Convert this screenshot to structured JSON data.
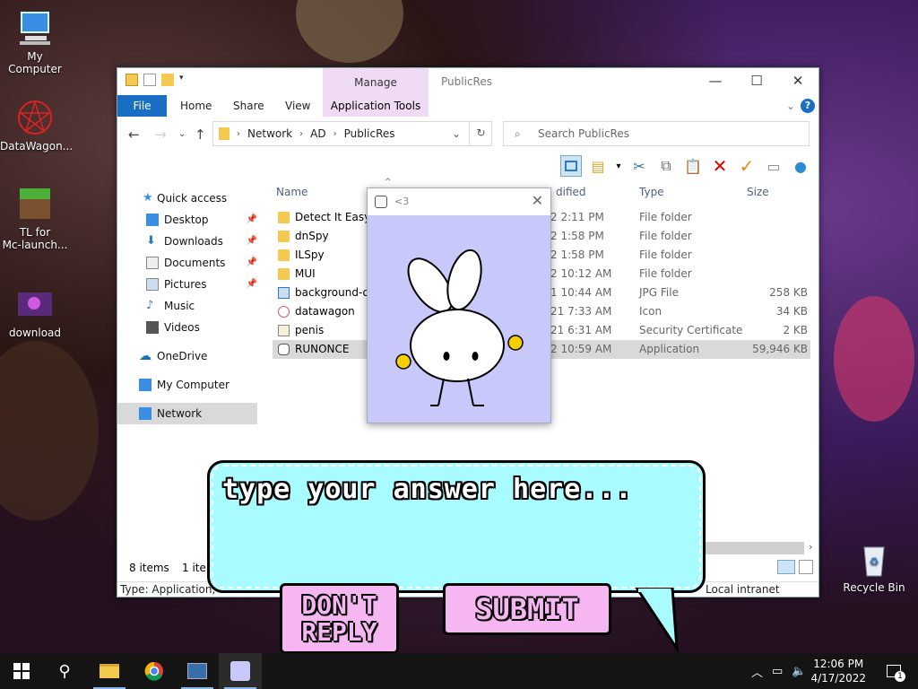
{
  "desktop": {
    "icons": [
      {
        "label": "My Computer"
      },
      {
        "label": "DataWagon..."
      },
      {
        "label": "TL for\nMc-launch..."
      },
      {
        "label": "download"
      },
      {
        "label": "Recycle Bin"
      }
    ]
  },
  "explorer": {
    "context_tab": "Manage",
    "window_title": "PublicRes",
    "ribbon_tabs": {
      "file": "File",
      "home": "Home",
      "share": "Share",
      "view": "View",
      "app_tools": "Application Tools"
    },
    "address": {
      "root": "Network",
      "mid": "AD",
      "current": "PublicRes"
    },
    "search_placeholder": "Search PublicRes",
    "nav": {
      "quick_access": "Quick access",
      "desktop": "Desktop",
      "downloads": "Downloads",
      "documents": "Documents",
      "pictures": "Pictures",
      "music": "Music",
      "videos": "Videos",
      "onedrive": "OneDrive",
      "my_computer": "My Computer",
      "network": "Network"
    },
    "columns": {
      "name": "Name",
      "modified": "dified",
      "type": "Type",
      "size": "Size"
    },
    "files": [
      {
        "name": "Detect It Easy",
        "date": "2 2:11 PM",
        "type": "File folder",
        "size": ""
      },
      {
        "name": "dnSpy",
        "date": "2 1:58 PM",
        "type": "File folder",
        "size": ""
      },
      {
        "name": "ILSpy",
        "date": "2 1:58 PM",
        "type": "File folder",
        "size": ""
      },
      {
        "name": "MUI",
        "date": "2 10:12 AM",
        "type": "File folder",
        "size": ""
      },
      {
        "name": "background-olo",
        "date": "1 10:44 AM",
        "type": "JPG File",
        "size": "258 KB"
      },
      {
        "name": "datawagon",
        "date": "21 7:33 AM",
        "type": "Icon",
        "size": "34 KB"
      },
      {
        "name": "penis",
        "date": "21 6:31 AM",
        "type": "Security Certificate",
        "size": "2 KB"
      },
      {
        "name": "RUNONCE",
        "date": "2 10:59 AM",
        "type": "Application",
        "size": "59,946 KB"
      }
    ],
    "status_count": "8 items",
    "status_sel": "1 item",
    "status_detail": "Type: Application, Si",
    "status_zone": "Local intranet"
  },
  "popup": {
    "title": "<3"
  },
  "bubble": {
    "prompt": "type your answer here...",
    "dont_reply_line1": "DON'T",
    "dont_reply_line2": "REPLY",
    "submit": "SUBMIT"
  },
  "taskbar": {
    "time": "12:06 PM",
    "date": "4/17/2022",
    "notif_count": "1"
  }
}
